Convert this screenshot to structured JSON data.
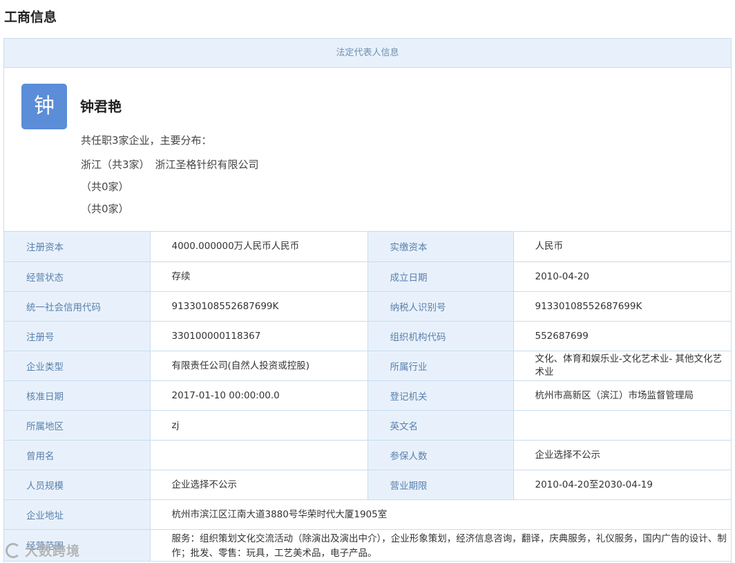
{
  "section_title": "工商信息",
  "legal_rep": {
    "header": "法定代表人信息",
    "avatar_char": "钟",
    "name": "钟君艳",
    "summary": "共任职3家企业，主要分布：",
    "distributions": [
      {
        "region": "浙江（共3家）",
        "company": "浙江圣格针织有限公司"
      },
      {
        "region": "（共0家）",
        "company": ""
      },
      {
        "region": "（共0家）",
        "company": ""
      }
    ]
  },
  "info_rows": [
    {
      "label1": "注册资本",
      "value1": "4000.000000万人民币人民币",
      "label2": "实缴资本",
      "value2": "人民币"
    },
    {
      "label1": "经营状态",
      "value1": "存续",
      "label2": "成立日期",
      "value2": "2010-04-20"
    },
    {
      "label1": "统一社会信用代码",
      "value1": "91330108552687699K",
      "label2": "纳税人识别号",
      "value2": "91330108552687699K"
    },
    {
      "label1": "注册号",
      "value1": "330100000118367",
      "label2": "组织机构代码",
      "value2": "552687699"
    },
    {
      "label1": "企业类型",
      "value1": "有限责任公司(自然人投资或控股)",
      "label2": "所属行业",
      "value2": "文化、体育和娱乐业-文化艺术业- 其他文化艺术业"
    },
    {
      "label1": "核准日期",
      "value1": "2017-01-10 00:00:00.0",
      "label2": "登记机关",
      "value2": "杭州市高新区（滨江）市场监督管理局"
    },
    {
      "label1": "所属地区",
      "value1": "zj",
      "label2": "英文名",
      "value2": ""
    },
    {
      "label1": "曾用名",
      "value1": "",
      "label2": "参保人数",
      "value2": "企业选择不公示"
    },
    {
      "label1": "人员规模",
      "value1": "企业选择不公示",
      "label2": "营业期限",
      "value2": "2010-04-20至2030-04-19"
    }
  ],
  "address": {
    "label": "企业地址",
    "value": "杭州市滨江区江南大道3880号华荣时代大厦1905室"
  },
  "business_scope": {
    "label": "经营范围",
    "value": "服务：组织策划文化交流活动（除演出及演出中介），企业形象策划，经济信息咨询，翻译，庆典服务，礼仪服务，国内广告的设计、制作；批发、零售：玩具，工艺美术品，电子产品。"
  },
  "watermark": "大数跨境",
  "colors": {
    "avatar_bg": "#5b8dd8",
    "label_bg": "#e8f1fb",
    "border": "#c9dcef",
    "label_text": "#5a80ad"
  }
}
